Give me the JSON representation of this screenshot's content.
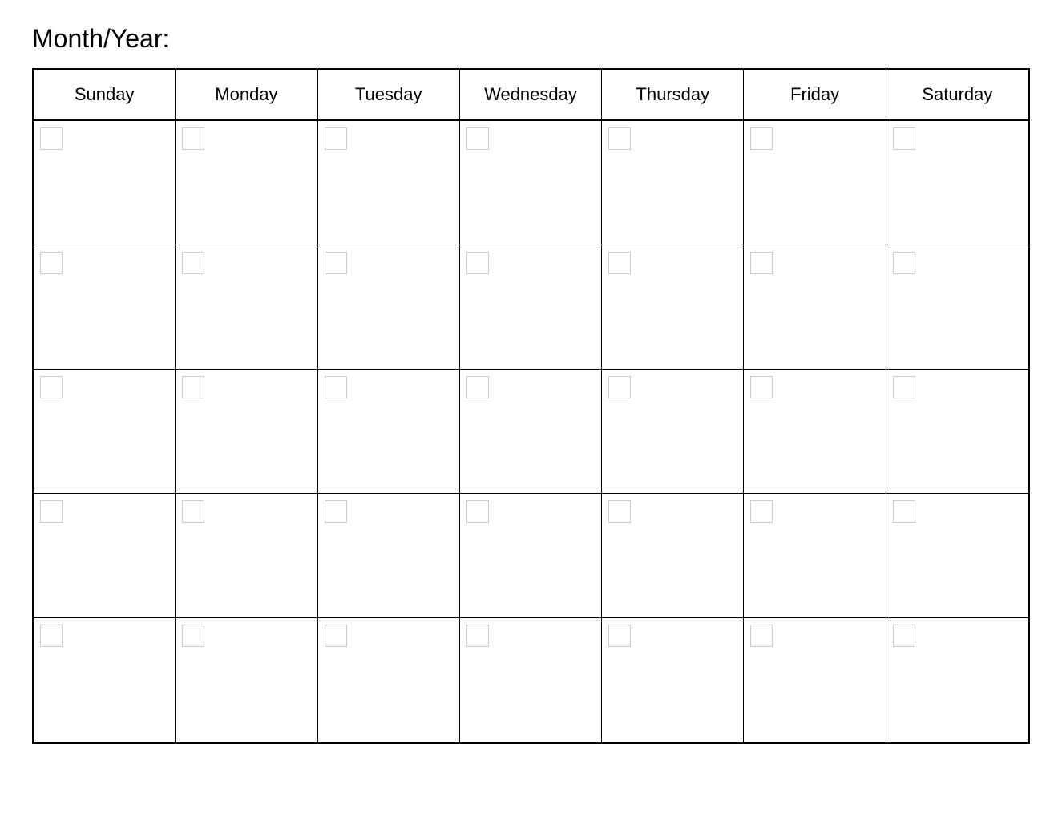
{
  "header": {
    "title": "Month/Year:"
  },
  "calendar": {
    "days": [
      "Sunday",
      "Monday",
      "Tuesday",
      "Wednesday",
      "Thursday",
      "Friday",
      "Saturday"
    ],
    "rows": 5
  }
}
